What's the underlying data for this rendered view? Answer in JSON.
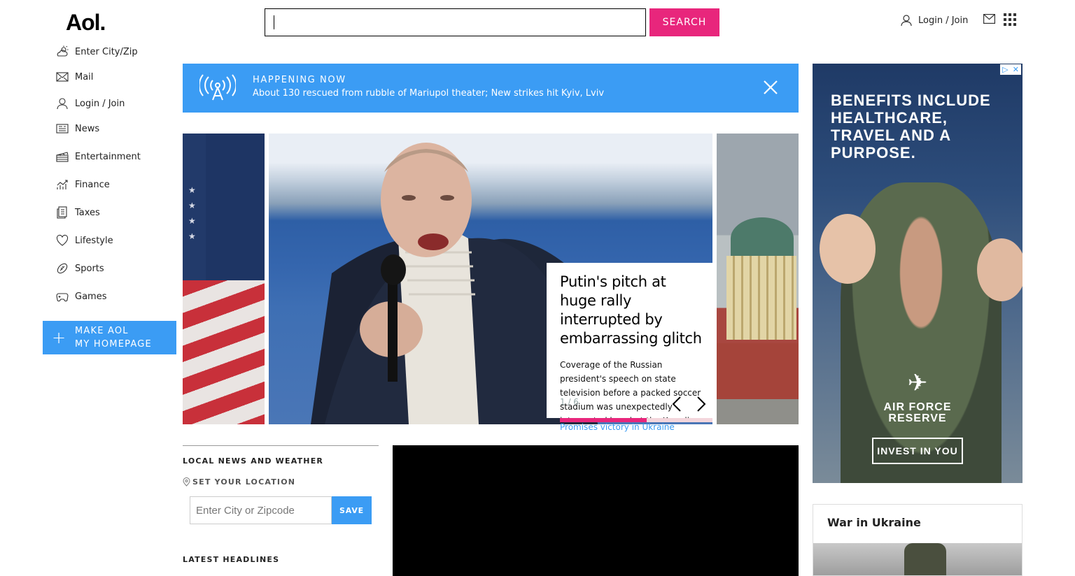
{
  "header": {
    "logo": "Aol.",
    "search_placeholder": "",
    "search_button": "SEARCH",
    "login_label": "Login / Join"
  },
  "sidebar": {
    "items": [
      {
        "label": "Enter City/Zip",
        "icon": "weather-icon"
      },
      {
        "label": "Mail",
        "icon": "mail-icon"
      },
      {
        "label": "Login / Join",
        "icon": "user-icon"
      },
      {
        "label": "News",
        "icon": "news-icon"
      },
      {
        "label": "Entertainment",
        "icon": "clapperboard-icon"
      },
      {
        "label": "Finance",
        "icon": "finance-chart-icon"
      },
      {
        "label": "Taxes",
        "icon": "documents-icon"
      },
      {
        "label": "Lifestyle",
        "icon": "heart-icon"
      },
      {
        "label": "Sports",
        "icon": "football-icon"
      },
      {
        "label": "Games",
        "icon": "gamepad-icon"
      }
    ],
    "make_homepage_line1": "MAKE AOL",
    "make_homepage_line2": "MY HOMEPAGE"
  },
  "happening": {
    "title": "HAPPENING NOW",
    "text": "About 130 rescued from rubble of Mariupol theater; New strikes hit Kyiv, Lviv"
  },
  "carousel": {
    "title": "Putin's pitch at huge rally interrupted by embarrassing glitch",
    "description": "Coverage of the Russian president's speech on state television before a packed soccer stadium was unexpectedly interrupted by what the Kremlin said was a server problem.",
    "counter": "1 / 6",
    "progress": 0.57,
    "next_story": "Promises victory in Ukraine"
  },
  "local_news": {
    "title": "LOCAL NEWS AND WEATHER",
    "set_location": "SET YOUR LOCATION",
    "input_placeholder": "Enter City or Zipcode",
    "save_label": "SAVE",
    "latest_headlines": "LATEST HEADLINES"
  },
  "ad": {
    "headline": "BENEFITS INCLUDE HEALTHCARE, TRAVEL AND A PURPOSE.",
    "brand_line1": "AIR FORCE",
    "brand_line2": "RESERVE",
    "cta": "INVEST IN YOU"
  },
  "war_module": {
    "title": "War in Ukraine"
  },
  "colors": {
    "accent_blue": "#3b9cf4",
    "search_pink": "#e8267c"
  }
}
